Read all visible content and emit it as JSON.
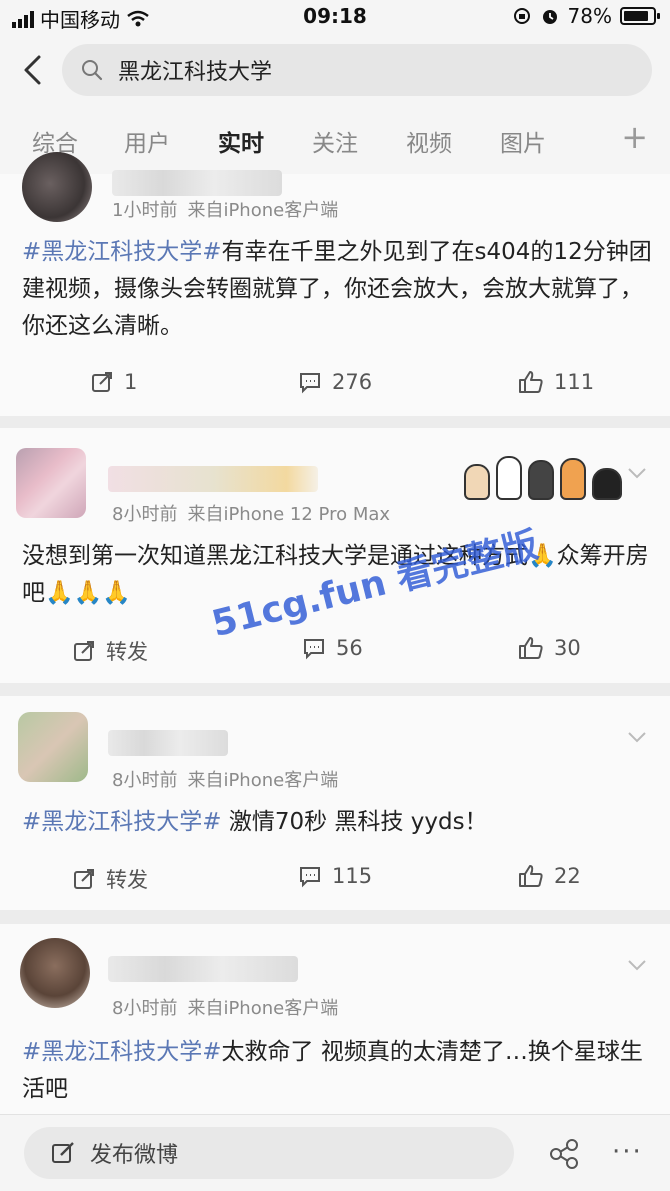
{
  "status_bar": {
    "carrier": "中国移动",
    "time": "09:18",
    "battery": "78%"
  },
  "search": {
    "query": "黑龙江科技大学"
  },
  "tabs": [
    {
      "label": "综合"
    },
    {
      "label": "用户"
    },
    {
      "label": "实时",
      "active": true
    },
    {
      "label": "关注"
    },
    {
      "label": "视频"
    },
    {
      "label": "图片"
    }
  ],
  "tab_add": "+",
  "posts": [
    {
      "time": "1小时前",
      "source": "来自iPhone客户端",
      "hashtag": "#黑龙江科技大学#",
      "text": "有幸在千里之外见到了在s404的12分钟团建视频，摄像头会转圈就算了，你还会放大，会放大就算了，你还这么清晰。",
      "repost": "1",
      "comments": "276",
      "likes": "111"
    },
    {
      "time": "8小时前",
      "source": "来自iPhone 12 Pro Max",
      "hashtag": "",
      "text": "没想到第一次知道黑龙江科技大学是通过这种方式🙏众筹开房吧🙏🙏🙏",
      "repost": "转发",
      "comments": "56",
      "likes": "30"
    },
    {
      "time": "8小时前",
      "source": "来自iPhone客户端",
      "hashtag": "#黑龙江科技大学#",
      "text": " 激情70秒 黑科技 yyds！",
      "repost": "转发",
      "comments": "115",
      "likes": "22"
    },
    {
      "time": "8小时前",
      "source": "来自iPhone客户端",
      "hashtag": "#黑龙江科技大学#",
      "text": "太救命了 视频真的太清楚了…换个星球生活吧"
    }
  ],
  "bottom": {
    "compose_label": "发布微博",
    "more": "···"
  },
  "watermark": "51cg.fun 看完整版",
  "colors": {
    "hashtag": "#5b78b5",
    "watermark": "#2f5bd6"
  }
}
